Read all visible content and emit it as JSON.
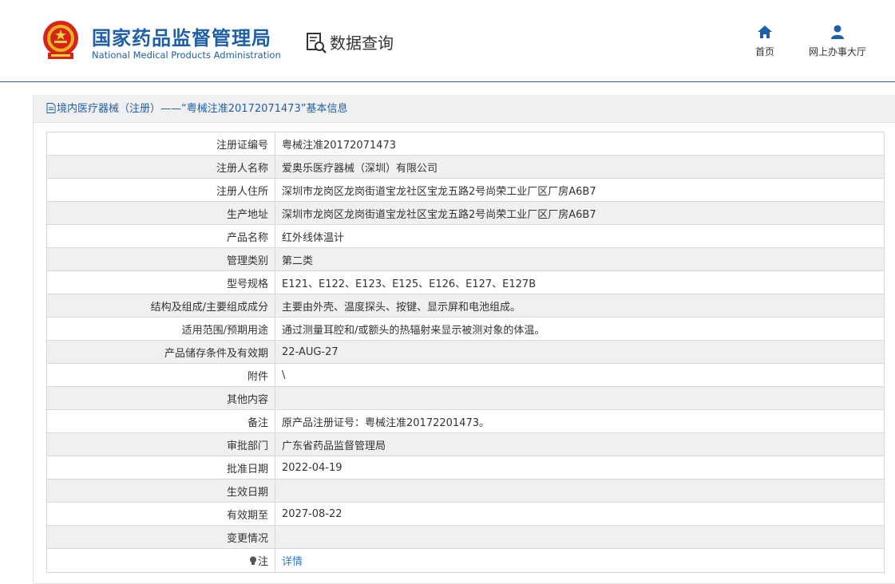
{
  "header": {
    "logo_cn": "国家药品监督管理局",
    "logo_en": "National Medical Products Administration",
    "search_title": "数据查询",
    "nav": {
      "home_label": "首页",
      "hall_label": "网上办事大厅"
    }
  },
  "panel": {
    "title": "境内医疗器械（注册）——“粤械注准20172071473”基本信息"
  },
  "rows": [
    {
      "label": "注册证编号",
      "value": "粤械注准20172071473"
    },
    {
      "label": "注册人名称",
      "value": "爱奥乐医疗器械（深圳）有限公司"
    },
    {
      "label": "注册人住所",
      "value": "深圳市龙岗区龙岗街道宝龙社区宝龙五路2号尚荣工业厂区厂房A6B7"
    },
    {
      "label": "生产地址",
      "value": "深圳市龙岗区龙岗街道宝龙社区宝龙五路2号尚荣工业厂区厂房A6B7"
    },
    {
      "label": "产品名称",
      "value": "红外线体温计"
    },
    {
      "label": "管理类别",
      "value": "第二类"
    },
    {
      "label": "型号规格",
      "value": "E121、E122、E123、E125、E126、E127、E127B"
    },
    {
      "label": "结构及组成/主要组成成分",
      "value": "主要由外壳、温度探头、按键、显示屏和电池组成。"
    },
    {
      "label": "适用范围/预期用途",
      "value": "通过测量耳腔和/或额头的热辐射来显示被测对象的体温。"
    },
    {
      "label": "产品储存条件及有效期",
      "value": "22-AUG-27"
    },
    {
      "label": "附件",
      "value": "\\"
    },
    {
      "label": "其他内容",
      "value": ""
    },
    {
      "label": "备注",
      "value": "原产品注册证号：粤械注准20172201473。"
    },
    {
      "label": "审批部门",
      "value": "广东省药品监督管理局"
    },
    {
      "label": "批准日期",
      "value": "2022-04-19"
    },
    {
      "label": "生效日期",
      "value": ""
    },
    {
      "label": "有效期至",
      "value": "2027-08-22"
    },
    {
      "label": "变更情况",
      "value": ""
    }
  ],
  "note_row": {
    "label": "注",
    "link_text": "详情"
  },
  "colors": {
    "brand_blue": "#1f5fa8",
    "link_blue": "#2b79c2",
    "stripe_gray": "#f0f0f0"
  },
  "icons": {
    "emblem": "national-emblem-icon",
    "search": "data-search-icon",
    "home": "home-icon",
    "hall": "user-icon",
    "doc": "document-icon",
    "note": "lightbulb-icon"
  }
}
